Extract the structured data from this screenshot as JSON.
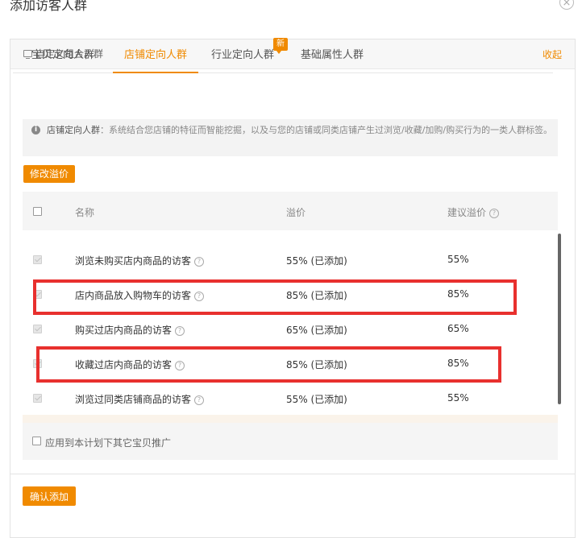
{
  "dialog": {
    "title": "添加访客人群",
    "close_icon": "close-icon"
  },
  "panel": {
    "title": "自定义组合人群",
    "collapse_label": "收起"
  },
  "tabs": [
    {
      "label": "宝贝定向人群",
      "active": false
    },
    {
      "label": "店铺定向人群",
      "active": true
    },
    {
      "label": "行业定向人群",
      "active": false,
      "badge": "新"
    },
    {
      "label": "基础属性人群",
      "active": false
    }
  ],
  "info": {
    "label": "店铺定向人群",
    "text": "：系统结合您店铺的特征而智能挖掘，以及与您的店铺或同类店铺产生过浏览/收藏/加购/购买行为的一类人群标签。"
  },
  "edit_button": "修改溢价",
  "table": {
    "headers": {
      "name": "名称",
      "premium": "溢价",
      "suggested": "建议溢价"
    },
    "rows": [
      {
        "name": "浏览未购买店内商品的访客",
        "premium": "55% (已添加)",
        "suggested": "55%"
      },
      {
        "name": "店内商品放入购物车的访客",
        "premium": "85% (已添加)",
        "suggested": "85%"
      },
      {
        "name": "购买过店内商品的访客",
        "premium": "65% (已添加)",
        "suggested": "65%"
      },
      {
        "name": "收藏过店内商品的访客",
        "premium": "85% (已添加)",
        "suggested": "85%"
      },
      {
        "name": "浏览过同类店铺商品的访客",
        "premium": "55% (已添加)",
        "suggested": "55%"
      }
    ]
  },
  "apply_label": "应用到本计划下其它宝贝推广",
  "confirm_button": "确认添加",
  "colors": {
    "accent": "#f08a00",
    "highlight": "#e8302e"
  }
}
